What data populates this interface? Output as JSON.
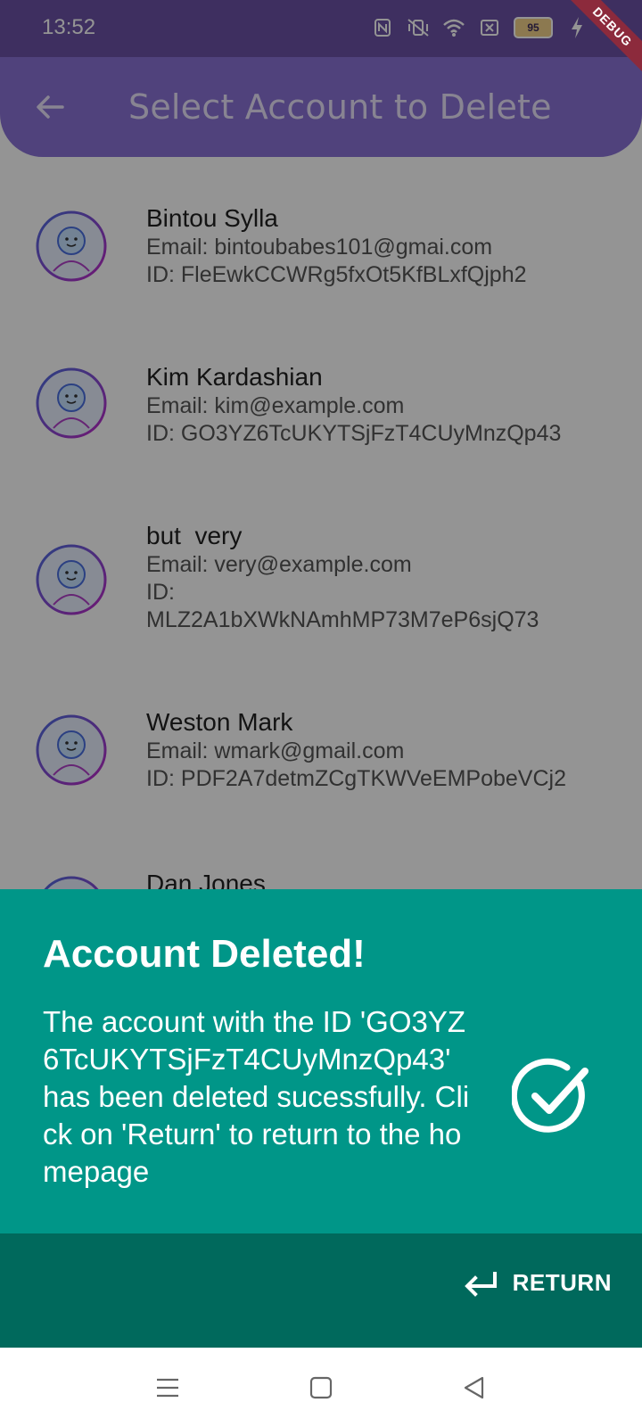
{
  "status_bar": {
    "time": "13:52",
    "battery_level": "95",
    "icons": [
      "nfc-icon",
      "vibrate-off-icon",
      "wifi-icon",
      "close-box-icon",
      "battery-icon",
      "charging-icon"
    ]
  },
  "debug_banner": "DEBUG",
  "app_bar": {
    "title": "Select Account to Delete",
    "back_icon": "arrow-back-icon"
  },
  "accounts": [
    {
      "name": "Bintou Sylla",
      "email": "Email:  bintoubabes101@gmai.com",
      "id_line": "ID: FleEwkCCWRg5fxOt5KfBLxfQjph2"
    },
    {
      "name": "Kim Kardashian",
      "email": "Email: kim@example.com",
      "id_line": "ID: GO3YZ6TcUKYTSjFzT4CUyMnzQp43"
    },
    {
      "name": "but  very",
      "email": "Email: very@example.com",
      "id_label": "ID:",
      "id_value": "MLZ2A1bXWkNAmhMP73M7eP6sjQ73"
    },
    {
      "name": "Weston Mark",
      "email": "Email: wmark@gmail.com",
      "id_line": "ID: PDF2A7detmZCgTKWVeEMPobeVCj2"
    },
    {
      "name": "Dan Jones"
    }
  ],
  "sheet": {
    "title": "Account Deleted!",
    "message": "The account with the ID 'GO3YZ6TcUKYTSjFzT4CUyMnzQp43' has been deleted sucessfully. Click on 'Return' to return to the homepage",
    "icon": "check-circle-icon",
    "return_label": "RETURN",
    "return_icon": "keyboard-return-icon"
  },
  "colors": {
    "sheet_bg": "#009688",
    "action_bg": "#00695c",
    "appbar_bg": "#8a73d6"
  },
  "nav_bar": {
    "icons": [
      "menu-icon",
      "home-square-icon",
      "back-triangle-icon"
    ]
  }
}
